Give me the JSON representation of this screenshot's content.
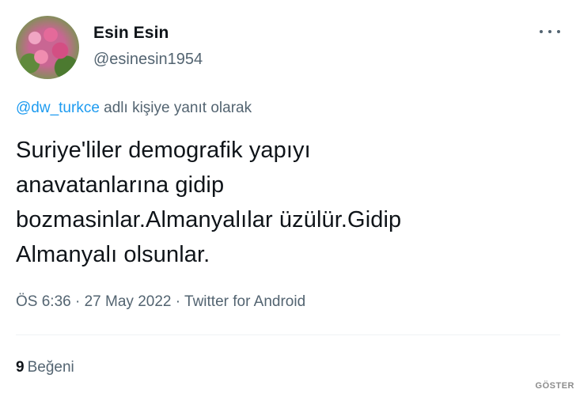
{
  "author": {
    "display_name": "Esin Esin",
    "handle": "@esinesin1954"
  },
  "reply": {
    "mention": "@dw_turkce",
    "suffix": " adlı kişiye yanıt olarak"
  },
  "tweet": {
    "lines": [
      "Suriye'liler demografik yapıyı",
      "anavatanlarına gidip",
      "bozmasinlar.Almanyalılar üzülür.Gidip",
      "Almanyalı olsunlar."
    ],
    "time": "ÖS 6:36",
    "date": "27 May 2022",
    "source": "Twitter for Android",
    "separator": " · "
  },
  "stats": {
    "likes_count": "9",
    "likes_label": "Beğeni"
  },
  "watermark": "GÖSTER",
  "icons": {
    "more": "more-horizontal-icon"
  },
  "colors": {
    "text": "#0f1419",
    "secondary": "#536471",
    "link": "#1d9bf0"
  }
}
